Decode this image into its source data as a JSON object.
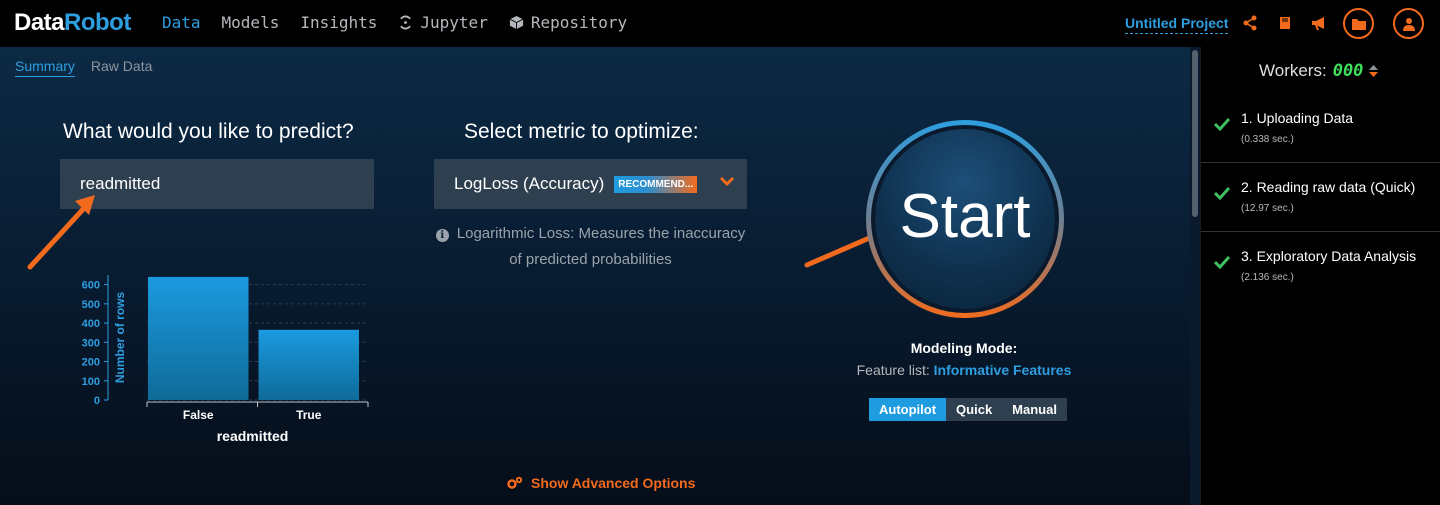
{
  "logo": {
    "part1": "Data",
    "part2": "Robot"
  },
  "nav": [
    {
      "label": "Data",
      "active": true
    },
    {
      "label": "Models",
      "active": false
    },
    {
      "label": "Insights",
      "active": false
    },
    {
      "label": "Jupyter",
      "active": false,
      "icon": "jupyter-icon"
    },
    {
      "label": "Repository",
      "active": false,
      "icon": "cube-icon"
    }
  ],
  "header": {
    "project_name": "Untitled Project",
    "icons": [
      "share-icon",
      "book-icon",
      "megaphone-icon",
      "folder-icon",
      "user-icon"
    ]
  },
  "subtabs": [
    {
      "label": "Summary",
      "active": true
    },
    {
      "label": "Raw Data",
      "active": false
    }
  ],
  "predict": {
    "title": "What would you like to predict?",
    "target_value": "readmitted"
  },
  "metric": {
    "title": "Select metric to optimize:",
    "selected": "LogLoss (Accuracy)",
    "badge": "RECOMMEND...",
    "description": "Logarithmic Loss: Measures the inaccuracy of predicted probabilities"
  },
  "start": {
    "label": "Start",
    "modeling_mode_title": "Modeling Mode:",
    "feature_list_prefix": "Feature list:",
    "feature_list_value": "Informative Features",
    "modes": [
      {
        "label": "Autopilot",
        "active": true
      },
      {
        "label": "Quick",
        "active": false
      },
      {
        "label": "Manual",
        "active": false
      }
    ]
  },
  "advanced_options": "Show Advanced Options",
  "workers": {
    "label": "Workers:",
    "count": "000"
  },
  "stages": [
    {
      "name": "1. Uploading Data",
      "time": "(0.338 sec.)",
      "status": "done"
    },
    {
      "name": "2. Reading raw data (Quick)",
      "time": "(12.97 sec.)",
      "status": "done"
    },
    {
      "name": "3. Exploratory Data Analysis",
      "time": "(2.136 sec.)",
      "status": "done"
    }
  ],
  "colors": {
    "accent_blue": "#2d9ee0",
    "accent_orange": "#f26b1d",
    "check_green": "#3ec060"
  },
  "chart_data": {
    "type": "bar",
    "categories": [
      "False",
      "True"
    ],
    "values": [
      640,
      365
    ],
    "xlabel": "readmitted",
    "ylabel": "Number of rows",
    "yticks": [
      0,
      100,
      200,
      300,
      400,
      500,
      600
    ],
    "ylim": [
      0,
      650
    ],
    "grid": true
  }
}
